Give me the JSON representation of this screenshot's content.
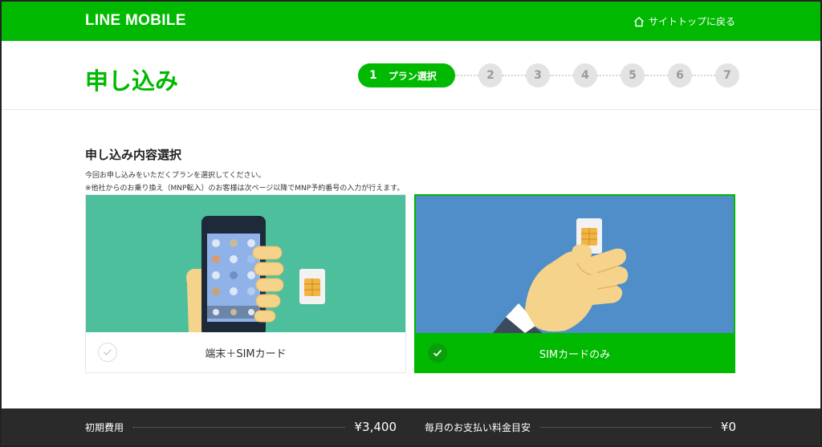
{
  "header": {
    "logo": "LINE MOBILE",
    "site_top_link": "サイトトップに戻る",
    "home_icon": "home-icon"
  },
  "page": {
    "title": "申し込み"
  },
  "steps": {
    "active": {
      "number": "1",
      "label": "プラン選択"
    },
    "others": [
      "2",
      "3",
      "4",
      "5",
      "6",
      "7"
    ]
  },
  "section": {
    "title": "申し込み内容選択",
    "desc1": "今回お申し込みをいただくプランを選択してください。",
    "desc2": "※他社からのお乗り換え（MNP転入）のお客様は次ページ以降でMNP予約番号の入力が行えます。"
  },
  "options": [
    {
      "label": "端末＋SIMカード",
      "selected": false,
      "image_color": "#4dbf9c"
    },
    {
      "label": "SIMカードのみ",
      "selected": true,
      "image_color": "#4f8ec9"
    }
  ],
  "footer": {
    "initial_cost_label": "初期費用",
    "initial_cost_value": "¥3,400",
    "monthly_label": "毎月のお支払い料金目安",
    "monthly_value": "¥0"
  },
  "colors": {
    "brand_green": "#00b900",
    "footer_bg": "#2a2a2a"
  }
}
